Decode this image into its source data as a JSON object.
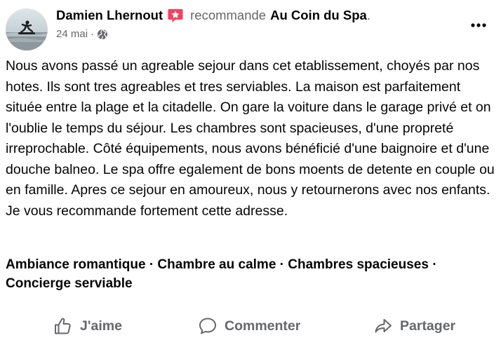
{
  "post": {
    "author": "Damien Lhernout",
    "verb": "recommande",
    "page": "Au Coin du Spa",
    "end_punct": ".",
    "date": "24 mai",
    "separator": "·",
    "badge_icon": "recommend-star-icon",
    "privacy_icon": "globe-icon",
    "more_icon": "more-options-icon",
    "text": "Nous avons passé un agreable sejour dans cet etablissement, choyés par nos hotes. Ils sont tres agreables et tres serviables. La maison est parfaitement située entre la plage et la citadelle. On gare la voiture dans le garage privé et on l'oublie le temps du séjour. Les chambres sont spacieuses, d'une propreté irreprochable. Côté équipements, nous avons bénéficié d'une baignoire et d'une douche balneo. Le spa offre egalement de bons moents de detente en couple ou en famille. Apres ce sejour en amoureux, nous y retournerons avec nos enfants. Je vous recommande fortement cette adresse.",
    "tags": "Ambiance romantique · Chambre au calme · Chambres spacieuses · Concierge serviable"
  },
  "actions": {
    "like": "J'aime",
    "comment": "Commenter",
    "share": "Partager"
  },
  "colors": {
    "text_primary": "#050505",
    "text_secondary": "#65676b",
    "badge": "#f3425f"
  }
}
